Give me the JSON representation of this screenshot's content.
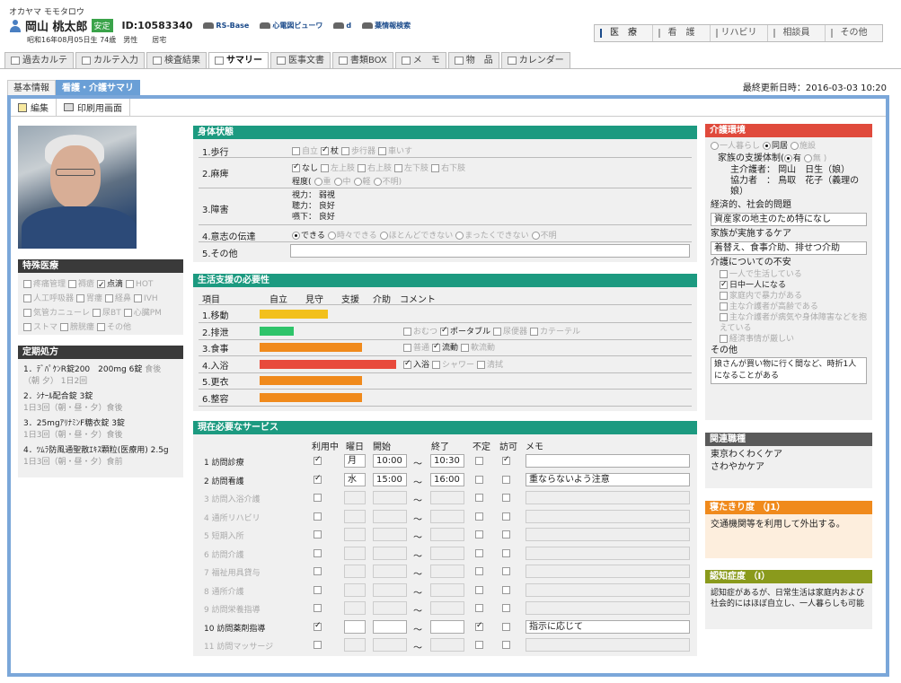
{
  "patient": {
    "kana": "オカヤマ モモタロウ",
    "name": "岡山 桃太郎",
    "status_badge": "安定",
    "id": "ID:10583340",
    "info": "昭和16年08月05日生 74歳　男性　　居宅",
    "links": [
      "RS-Base",
      "心電図ビューワ",
      "d",
      "薬情報検索"
    ]
  },
  "roles": [
    "医　療",
    "看　護",
    "リハビリ",
    "相談員",
    "その他"
  ],
  "tabs": [
    "過去カルテ",
    "カルテ入力",
    "検査結果",
    "サマリー",
    "医事文書",
    "書類BOX",
    "メ　モ",
    "物　品",
    "カレンダー"
  ],
  "subtabs": [
    "基本情報",
    "看護・介護サマリ"
  ],
  "updated": "最終更新日時：2016-03-03 10:20",
  "toolbar": {
    "edit": "編集",
    "print": "印刷用画面"
  },
  "special": {
    "title": "特殊医療",
    "items": [
      {
        "l": "疼痛管理",
        "on": false
      },
      {
        "l": "褥瘡",
        "on": false
      },
      {
        "l": "点滴",
        "on": true
      },
      {
        "l": "HOT",
        "on": false
      },
      {
        "l": "人工呼吸器",
        "on": false
      },
      {
        "l": "胃瘻",
        "on": false
      },
      {
        "l": "経鼻",
        "on": false
      },
      {
        "l": "IVH",
        "on": false
      },
      {
        "l": "気管カニューレ",
        "on": false
      },
      {
        "l": "尿BT",
        "on": false
      },
      {
        "l": "心臓PM",
        "on": false
      },
      {
        "l": "ストマ",
        "on": false
      },
      {
        "l": "膀胱瘻",
        "on": false
      },
      {
        "l": "その他",
        "on": false
      }
    ]
  },
  "rx": {
    "title": "定期処方",
    "items": [
      {
        "n": "1．ﾃﾞﾊﾟｹﾝR錠200　200mg 6錠",
        "u": "食後",
        "d": "（朝 夕） 1日2回"
      },
      {
        "n": "2．ｼﾅｰﾙ配合錠 3錠",
        "u": "",
        "d": "1日3回（朝・昼・夕）食後"
      },
      {
        "n": "3．25mgｱﾘﾅﾐﾝF糖衣錠 3錠",
        "u": "",
        "d": "1日3回（朝・昼・夕）食後"
      },
      {
        "n": "4．ﾂﾑﾗ防風通聖散ｴｷｽ顆粒(医療用) 2.5g",
        "u": "",
        "d": "1日3回（朝・昼・夕）食前"
      }
    ]
  },
  "body": {
    "title": "身体状態",
    "walk": {
      "label": "1.歩行",
      "opts": [
        {
          "l": "自立",
          "on": false
        },
        {
          "l": "杖",
          "on": true
        },
        {
          "l": "歩行器",
          "on": false
        },
        {
          "l": "車いす",
          "on": false
        }
      ]
    },
    "paralysis": {
      "label": "2.麻痺",
      "opts": [
        {
          "l": "なし",
          "on": true
        },
        {
          "l": "左上肢",
          "on": false
        },
        {
          "l": "右上肢",
          "on": false
        },
        {
          "l": "左下肢",
          "on": false
        },
        {
          "l": "右下肢",
          "on": false
        }
      ],
      "degree_label": "程度(",
      "degree": [
        {
          "l": "重",
          "on": false
        },
        {
          "l": "中",
          "on": false
        },
        {
          "l": "軽",
          "on": false
        },
        {
          "l": "不明)",
          "on": false
        }
      ]
    },
    "disability": {
      "label": "3.障害",
      "lines": [
        "視力： 弱視",
        "聴力： 良好",
        "嚥下： 良好"
      ]
    },
    "comm": {
      "label": "4.意志の伝達",
      "opts": [
        {
          "l": "できる",
          "on": true
        },
        {
          "l": "時々できる",
          "on": false
        },
        {
          "l": "ほとんどできない",
          "on": false
        },
        {
          "l": "まったくできない",
          "on": false
        },
        {
          "l": "不明",
          "on": false
        }
      ]
    },
    "other": {
      "label": "5.その他",
      "value": ""
    }
  },
  "need": {
    "title": "生活支援の必要性",
    "headers": [
      "項目",
      "自立",
      "見守",
      "支援",
      "介助",
      "コメント"
    ],
    "rows": [
      {
        "label": "1.移動",
        "level": 2,
        "color": "#f2c01c",
        "opts": []
      },
      {
        "label": "2.排泄",
        "level": 1,
        "color": "#2fc46a",
        "opts": [
          {
            "l": "おむつ",
            "on": false
          },
          {
            "l": "ポータブル",
            "on": true
          },
          {
            "l": "尿便器",
            "on": false
          },
          {
            "l": "カテーテル",
            "on": false
          }
        ]
      },
      {
        "label": "3.食事",
        "level": 3,
        "color": "#f08a1c",
        "opts": [
          {
            "l": "普通",
            "on": false
          },
          {
            "l": "流動",
            "on": true
          },
          {
            "l": "軟流動",
            "on": false
          }
        ]
      },
      {
        "label": "4.入浴",
        "level": 4,
        "color": "#e84a3c",
        "opts": [
          {
            "l": "入浴",
            "on": true
          },
          {
            "l": "シャワー",
            "on": false
          },
          {
            "l": "清拭",
            "on": false
          }
        ]
      },
      {
        "label": "5.更衣",
        "level": 3,
        "color": "#f08a1c",
        "opts": []
      },
      {
        "label": "6.整容",
        "level": 3,
        "color": "#f08a1c",
        "opts": []
      }
    ]
  },
  "svc": {
    "title": "現在必要なサービス",
    "headers": [
      "利用中",
      "曜日",
      "開始",
      "終了",
      "不定",
      "訪可",
      "メモ"
    ],
    "rows": [
      {
        "label": "1 訪問診療",
        "active": true,
        "use": true,
        "day": "月",
        "start": "10:00",
        "end": "10:30",
        "fix": false,
        "visit": true,
        "memo": ""
      },
      {
        "label": "2 訪問看護",
        "active": true,
        "use": true,
        "day": "水",
        "start": "15:00",
        "end": "16:00",
        "fix": false,
        "visit": false,
        "memo": "重ならないよう注意"
      },
      {
        "label": "3 訪問入浴介護",
        "active": false,
        "use": false,
        "day": "",
        "start": "",
        "end": "",
        "fix": false,
        "visit": false,
        "memo": ""
      },
      {
        "label": "4 通所リハビリ",
        "active": false,
        "use": false,
        "day": "",
        "start": "",
        "end": "",
        "fix": false,
        "visit": false,
        "memo": ""
      },
      {
        "label": "5 短期入所",
        "active": false,
        "use": false,
        "day": "",
        "start": "",
        "end": "",
        "fix": false,
        "visit": false,
        "memo": ""
      },
      {
        "label": "6 訪問介護",
        "active": false,
        "use": false,
        "day": "",
        "start": "",
        "end": "",
        "fix": false,
        "visit": false,
        "memo": ""
      },
      {
        "label": "7 福祉用具貸与",
        "active": false,
        "use": false,
        "day": "",
        "start": "",
        "end": "",
        "fix": false,
        "visit": false,
        "memo": ""
      },
      {
        "label": "8 通所介護",
        "active": false,
        "use": false,
        "day": "",
        "start": "",
        "end": "",
        "fix": false,
        "visit": false,
        "memo": ""
      },
      {
        "label": "9 訪問栄養指導",
        "active": false,
        "use": false,
        "day": "",
        "start": "",
        "end": "",
        "fix": false,
        "visit": false,
        "memo": ""
      },
      {
        "label": "10 訪問薬剤指導",
        "active": true,
        "use": true,
        "day": "",
        "start": "",
        "end": "",
        "fix": true,
        "visit": false,
        "memo": "指示に応じて"
      },
      {
        "label": "11 訪問マッサージ",
        "active": false,
        "use": false,
        "day": "",
        "start": "",
        "end": "",
        "fix": false,
        "visit": false,
        "memo": ""
      }
    ]
  },
  "care": {
    "title": "介護環境",
    "living": [
      {
        "l": "一人暮らし",
        "on": false
      },
      {
        "l": "同居",
        "on": true
      },
      {
        "l": "施設",
        "on": false
      }
    ],
    "support_label": "家族の支援体制(",
    "support": [
      {
        "l": "有",
        "on": true
      },
      {
        "l": "無 )",
        "on": false
      }
    ],
    "caregiver": "主介護者： 岡山　日生（娘）",
    "helper": "協力者　： 鳥取　花子（義理の娘）",
    "econ_label": "経済的、社会的問題",
    "econ": "資産家の地主のため特になし",
    "family_label": "家族が実施するケア",
    "family": "着替え、食事介助、排せつ介助",
    "anx_label": "介護についての不安",
    "anx": [
      {
        "l": "一人で生活している",
        "on": false
      },
      {
        "l": "日中一人になる",
        "on": true
      },
      {
        "l": "家庭内で暴力がある",
        "on": false
      },
      {
        "l": "主な介護者が高齢である",
        "on": false
      },
      {
        "l": "主な介護者が病気や身体障害などを抱えている",
        "on": false
      },
      {
        "l": "経済事情が厳しい",
        "on": false
      }
    ],
    "other_label": "その他",
    "other": "娘さんが買い物に行く間など、時折1人になることがある"
  },
  "kanren": {
    "title": "関連職種",
    "lines": [
      "東京わくわくケア",
      "さわやかケア"
    ]
  },
  "netakiri": {
    "title": "寝たきり度 （J1）",
    "text": "交通機関等を利用して外出する。"
  },
  "ninchi": {
    "title": "認知症度 （Ⅰ）",
    "text": "認知症があるが、日常生活は家庭内および社会的にはほぼ自立し、一人暮らしも可能"
  }
}
